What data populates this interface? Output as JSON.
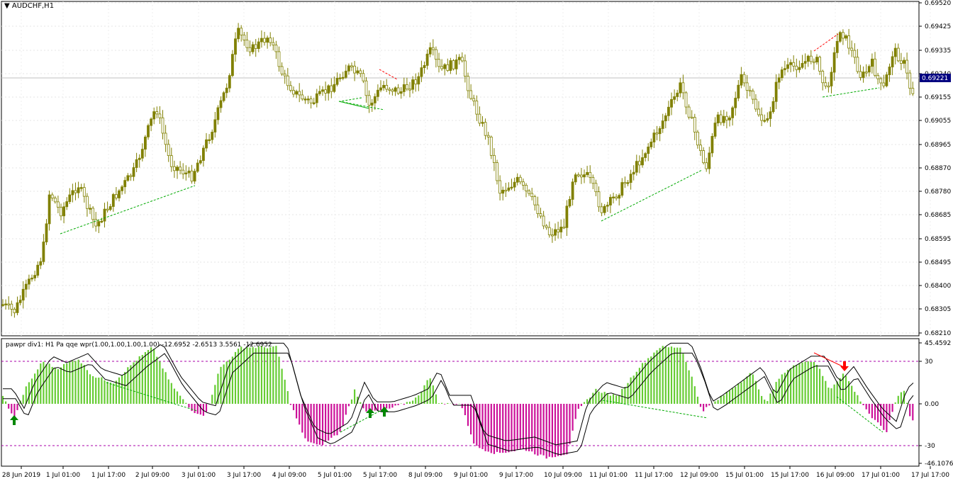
{
  "main_chart": {
    "title": "AUDCHF,H1",
    "price_labels": [
      "0.69520",
      "0.69425",
      "0.69335",
      "0.69240",
      "0.69155",
      "0.69055",
      "0.68965",
      "0.68870",
      "0.68780",
      "0.68685",
      "0.68595",
      "0.68495",
      "0.68400",
      "0.68305",
      "0.68210"
    ],
    "current_price": "0.69221",
    "colors": {
      "candle": "#808000",
      "bull_trend": "#00aa00",
      "bear_trend": "#ff0000",
      "price_tag_bg": "#000080"
    }
  },
  "indicator": {
    "title": "pawpr div1: H1  Pa qqe wpr(1.00,1.00,1.00,1.00) -12.6952 -2.6513 3.5561 -12.6952",
    "axis_labels": [
      "45.4592",
      "30",
      "0.00",
      "-30",
      "-46.1076"
    ],
    "colors": {
      "positive": "#66cc33",
      "negative": "#cc1199",
      "level": "#aa00aa"
    }
  },
  "time_axis": [
    "28 Jun 2019",
    "1 Jul 01:00",
    "1 Jul 17:00",
    "2 Jul 09:00",
    "3 Jul 01:00",
    "3 Jul 17:00",
    "4 Jul 09:00",
    "5 Jul 01:00",
    "5 Jul 17:00",
    "8 Jul 09:00",
    "9 Jul 01:00",
    "9 Jul 17:00",
    "10 Jul 09:00",
    "11 Jul 01:00",
    "11 Jul 17:00",
    "12 Jul 09:00",
    "15 Jul 01:00",
    "15 Jul 17:00",
    "16 Jul 09:00",
    "17 Jul 01:00",
    "17 Jul 17:00"
  ]
}
